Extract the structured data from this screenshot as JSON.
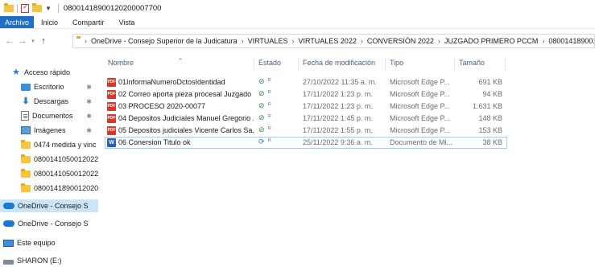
{
  "window": {
    "title": "08001418900120200007700"
  },
  "ribbon": {
    "tabs": [
      "Archivo",
      "Inicio",
      "Compartir",
      "Vista"
    ]
  },
  "address": {
    "segments": [
      "OneDrive - Consejo Superior de la Judicatura",
      "VIRTUALES",
      "VIRTUALES 2022",
      "CONVERSIÓN 2022",
      "JUZGADO PRIMERO PCCM",
      "08001418900120200007700"
    ]
  },
  "sidebar": {
    "items": [
      {
        "label": "Acceso rápido",
        "icon": "star-icon"
      },
      {
        "label": "Escritorio",
        "icon": "desktop-icon",
        "pinned": true
      },
      {
        "label": "Descargas",
        "icon": "download-icon",
        "pinned": true
      },
      {
        "label": "Documentos",
        "icon": "documents-icon",
        "pinned": true
      },
      {
        "label": "Imágenes",
        "icon": "images-icon",
        "pinned": true
      },
      {
        "label": "0474 medida y vinc",
        "icon": "folder-icon"
      },
      {
        "label": "080014105001202200",
        "icon": "folder-icon"
      },
      {
        "label": "080014105001202200",
        "icon": "folder-icon"
      },
      {
        "label": "080014189001202000",
        "icon": "folder-icon"
      },
      {
        "label": "OneDrive - Consejo S",
        "icon": "cloud-icon",
        "selected": true
      },
      {
        "label": "OneDrive - Consejo S",
        "icon": "cloud-icon"
      },
      {
        "label": "Este equipo",
        "icon": "computer-icon"
      },
      {
        "label": "SHARON (E:)",
        "icon": "drive-icon"
      }
    ]
  },
  "columns": {
    "name": "Nombre",
    "status": "Estado",
    "modified": "Fecha de modificación",
    "type": "Tipo",
    "size": "Tamaño"
  },
  "files": [
    {
      "name": "01InformaNumeroDctosIdentidad",
      "status": "ok",
      "modified": "27/10/2022 11:35 a. m.",
      "type": "Microsoft Edge P...",
      "size": "691 KB",
      "icon": "pdf-icon"
    },
    {
      "name": "02 Correo aporta pieza procesal Juzgado ...",
      "status": "ok",
      "modified": "17/11/2022 1:23 p. m.",
      "type": "Microsoft Edge P...",
      "size": "94 KB",
      "icon": "pdf-icon"
    },
    {
      "name": "03 PROCESO 2020-00077",
      "status": "ok",
      "modified": "17/11/2022 1:23 p. m.",
      "type": "Microsoft Edge P...",
      "size": "1.631 KB",
      "icon": "pdf-icon"
    },
    {
      "name": "04 Depositos Judiciales Manuel Gregorio ...",
      "status": "ok",
      "modified": "17/11/2022 1:45 p. m.",
      "type": "Microsoft Edge P...",
      "size": "148 KB",
      "icon": "pdf-icon"
    },
    {
      "name": "05 Depositos judiciales  Vicente Carlos Sa...",
      "status": "ok",
      "modified": "17/11/2022 1:55 p. m.",
      "type": "Microsoft Edge P...",
      "size": "153 KB",
      "icon": "pdf-icon"
    },
    {
      "name": "06 Conersion Titulo ok",
      "status": "sync",
      "modified": "25/11/2022 9:36 a. m.",
      "type": "Documento de Mi...",
      "size": "38 KB",
      "icon": "word-icon",
      "selected": true
    }
  ],
  "colors": {
    "accent": "#1f6fc5",
    "selection": "#cce4f7",
    "ok": "#2e8b3d",
    "sync": "#1b78d4"
  }
}
